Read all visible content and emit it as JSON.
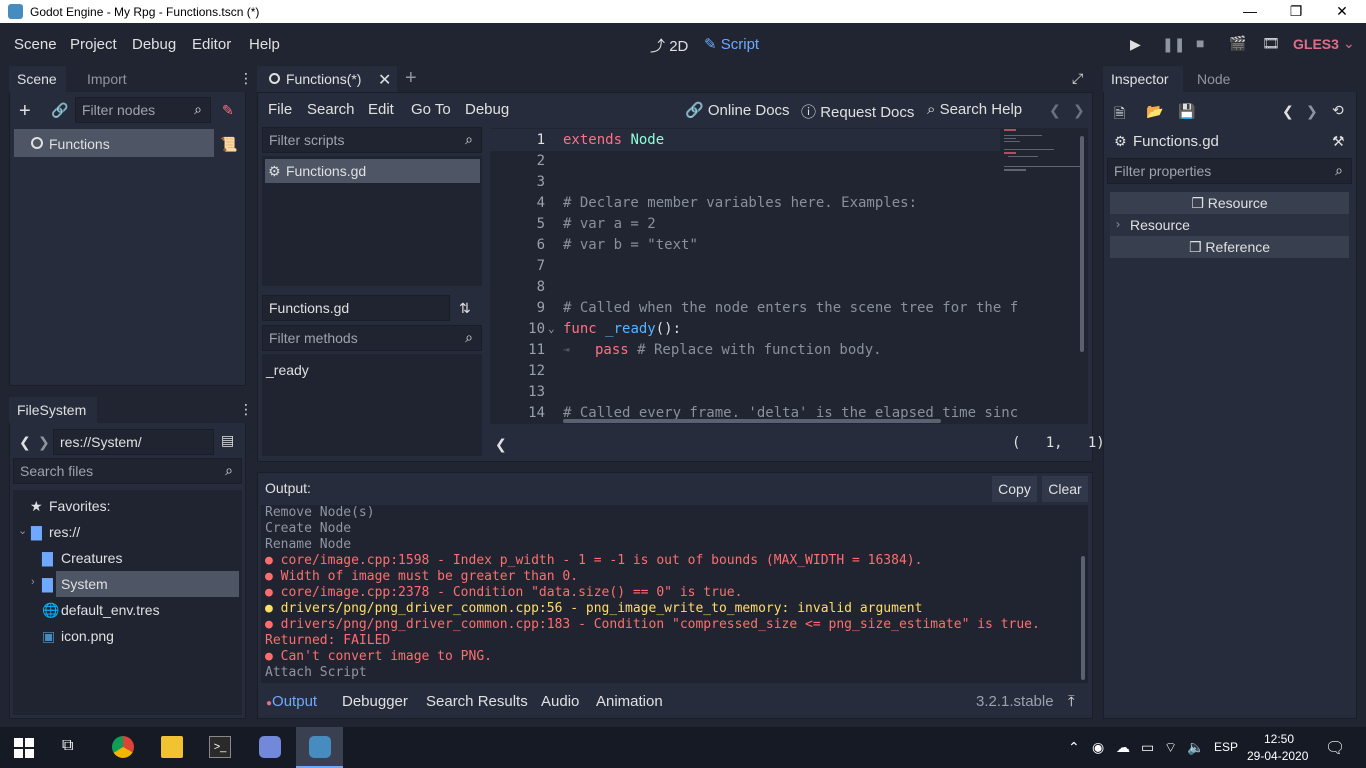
{
  "window": {
    "title": "Godot Engine - My Rpg - Functions.tscn (*)",
    "minimize": "—",
    "restore": "❐",
    "close": "✕"
  },
  "menu": {
    "items": [
      "Scene",
      "Project",
      "Debug",
      "Editor",
      "Help"
    ]
  },
  "workspaces": {
    "2d": "2D",
    "script": "Script"
  },
  "renderer": "GLES3",
  "scene_dock": {
    "tabs": [
      "Scene",
      "Import"
    ],
    "filter_placeholder": "Filter nodes",
    "root_node": "Functions"
  },
  "filesystem": {
    "tab": "FileSystem",
    "path": "res://System/",
    "search_placeholder": "Search files",
    "items": [
      "Favorites:",
      "res://",
      "Creatures",
      "System",
      "default_env.tres",
      "icon.png"
    ]
  },
  "editor_tabs": {
    "current": "Functions(*)"
  },
  "script_menu": {
    "items": [
      "File",
      "Search",
      "Edit",
      "Go To",
      "Debug"
    ],
    "online_docs": "Online Docs",
    "request_docs": "Request Docs",
    "search_help": "Search Help"
  },
  "scripts_list": {
    "filter_placeholder": "Filter scripts",
    "items": [
      "Functions.gd"
    ]
  },
  "methods": {
    "title": "Functions.gd",
    "filter_placeholder": "Filter methods",
    "items": [
      "_ready"
    ]
  },
  "code": {
    "line_numbers": [
      "1",
      "2",
      "3",
      "4",
      "5",
      "6",
      "7",
      "8",
      "9",
      "10",
      "11",
      "12",
      "13",
      "14"
    ],
    "l1_kw": "extends",
    "l1_ty": "Node",
    "l4": "# Declare member variables here. Examples:",
    "l5": "# var a = 2",
    "l6a": "# var b = ",
    "l6b": "\"text\"",
    "l9": "# Called when the node enters the scene tree for the f",
    "l10_kw": "func",
    "l10_fn": "_ready",
    "l10_p": "():",
    "l11_kw": "pass",
    "l11_cm": " # Replace with function body.",
    "l14": "# Called every frame. 'delta' is the elapsed time sinc",
    "cursor": "(   1,   1)"
  },
  "output": {
    "label": "Output:",
    "copy": "Copy",
    "clear": "Clear",
    "lines": [
      "Remove Node(s)",
      "Create Node",
      "Rename Node",
      "● core/image.cpp:1598 - Index p_width - 1 = -1 is out of bounds (MAX_WIDTH = 16384).",
      "● Width of image must be greater than 0.",
      "● core/image.cpp:2378 - Condition \"data.size() == 0\" is true.",
      "● drivers/png/png_driver_common.cpp:56 - png_image_write_to_memory: invalid argument",
      "● drivers/png/png_driver_common.cpp:183 - Condition \"compressed_size <= png_size_estimate\" is true.",
      "Returned: FAILED",
      "● Can't convert image to PNG.",
      "Attach Script"
    ]
  },
  "bottom_tabs": [
    "Output",
    "Debugger",
    "Search Results",
    "Audio",
    "Animation"
  ],
  "version": "3.2.1.stable",
  "inspector": {
    "tabs": [
      "Inspector",
      "Node"
    ],
    "resource_name": "Functions.gd",
    "filter_placeholder": "Filter properties",
    "sections": [
      "Resource",
      "Resource",
      "Reference"
    ]
  },
  "taskbar": {
    "lang": "ESP",
    "time": "12:50",
    "date": "29-04-2020"
  },
  "colors": {
    "accent": "#6ea9ff",
    "error": "#ff6e6e",
    "warning": "#ffdd65",
    "renderer": "#df6d8b"
  }
}
